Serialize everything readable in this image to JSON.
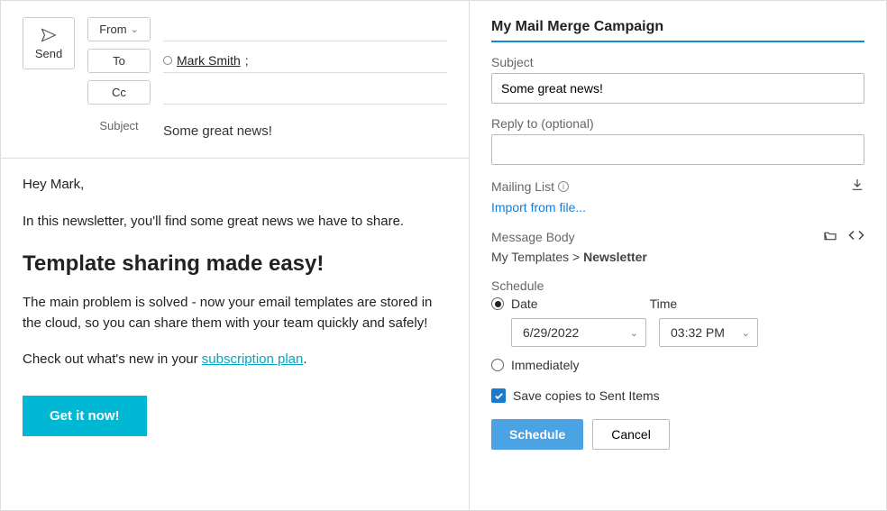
{
  "compose": {
    "send_label": "Send",
    "from_label": "From",
    "to_label": "To",
    "cc_label": "Cc",
    "subject_label": "Subject",
    "to_recipient": "Mark Smith",
    "subject_value": "Some great news!"
  },
  "body": {
    "greeting": "Hey Mark,",
    "intro": "In this newsletter, you'll find some great news we have to share.",
    "headline": "Template sharing made easy!",
    "para1": "The main problem is solved - now your email templates are stored in the cloud, so you can share them with your team quickly and safely!",
    "para2_pre": "Check out what's new in your ",
    "para2_link": "subscription plan",
    "para2_post": ".",
    "cta": "Get it now!"
  },
  "panel": {
    "title": "My Mail Merge Campaign",
    "subject_label": "Subject",
    "subject_value": "Some great news!",
    "reply_to_label": "Reply to (optional)",
    "reply_to_value": "",
    "mailing_list_label": "Mailing List",
    "import_link": "Import from file...",
    "message_body_label": "Message Body",
    "crumb_root": "My Templates",
    "crumb_sep": ">",
    "crumb_active": "Newsletter",
    "schedule_label": "Schedule",
    "radio_date_label": "Date",
    "time_label": "Time",
    "date_value": "6/29/2022",
    "time_value": "03:32 PM",
    "radio_immediately_label": "Immediately",
    "save_copies_label": "Save copies to Sent Items",
    "schedule_btn": "Schedule",
    "cancel_btn": "Cancel"
  }
}
